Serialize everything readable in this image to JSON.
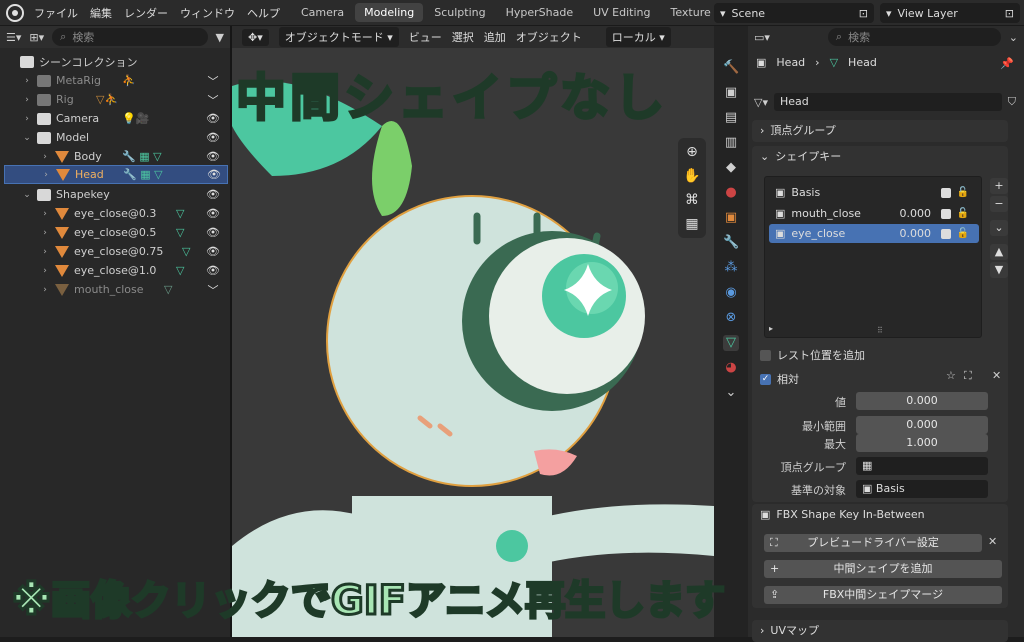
{
  "menu": [
    "ファイル",
    "編集",
    "レンダー",
    "ウィンドウ",
    "ヘルプ"
  ],
  "workspaces": [
    {
      "label": "Camera",
      "active": false
    },
    {
      "label": "Modeling",
      "active": true
    },
    {
      "label": "Sculpting",
      "active": false
    },
    {
      "label": "HyperShade",
      "active": false
    },
    {
      "label": "UV Editing",
      "active": false
    },
    {
      "label": "Texture Pain",
      "active": false
    }
  ],
  "scene": "Scene",
  "view_layer": "View Layer",
  "outliner": {
    "search_placeholder": "検索",
    "root": "シーンコレクション",
    "rows": [
      {
        "name": "MetaRig",
        "dim": true
      },
      {
        "name": "Rig",
        "dim": true
      },
      {
        "name": "Camera",
        "dim": false
      },
      {
        "name": "Model",
        "dim": false
      },
      {
        "name": "Body",
        "dim": false
      },
      {
        "name": "Head",
        "dim": false
      },
      {
        "name": "Shapekey",
        "dim": false
      },
      {
        "name": "eye_close@0.3",
        "dim": false
      },
      {
        "name": "eye_close@0.5",
        "dim": false
      },
      {
        "name": "eye_close@0.75",
        "dim": false
      },
      {
        "name": "eye_close@1.0",
        "dim": false
      },
      {
        "name": "mouth_close",
        "dim": true
      }
    ],
    "selected": "Head"
  },
  "viewport": {
    "mode": "オブジェクトモード",
    "menus": [
      "ビュー",
      "選択",
      "追加",
      "オブジェクト"
    ],
    "transform": "ローカル"
  },
  "properties": {
    "search_placeholder": "検索",
    "breadcrumb": [
      "Head",
      "Head"
    ],
    "data_name": "Head",
    "vertex_groups_panel": "頂点グループ",
    "shape_keys_panel": "シェイプキー",
    "shape_keys": [
      {
        "name": "Basis",
        "value": ""
      },
      {
        "name": "mouth_close",
        "value": "0.000"
      },
      {
        "name": "eye_close",
        "value": "0.000"
      }
    ],
    "add_rest_position": "レスト位置を追加",
    "relative": "相対",
    "value_label": "値",
    "value": "0.000",
    "min_label": "最小範囲",
    "min": "0.000",
    "max_label": "最大",
    "max": "1.000",
    "vgroup_label": "頂点グループ",
    "reference_label": "基準の対象",
    "reference": "Basis",
    "fbx_panel": "FBX Shape Key In-Between",
    "preview_driver": "プレビュードライバー設定",
    "add_inbetween": "中間シェイプを追加",
    "fbx_merge": "FBX中間シェイプマージ",
    "uv_panel": "UVマップ"
  },
  "overlay": {
    "title": "中間シェイプなし",
    "note": "※画像クリックでGIFアニメ再生します"
  }
}
